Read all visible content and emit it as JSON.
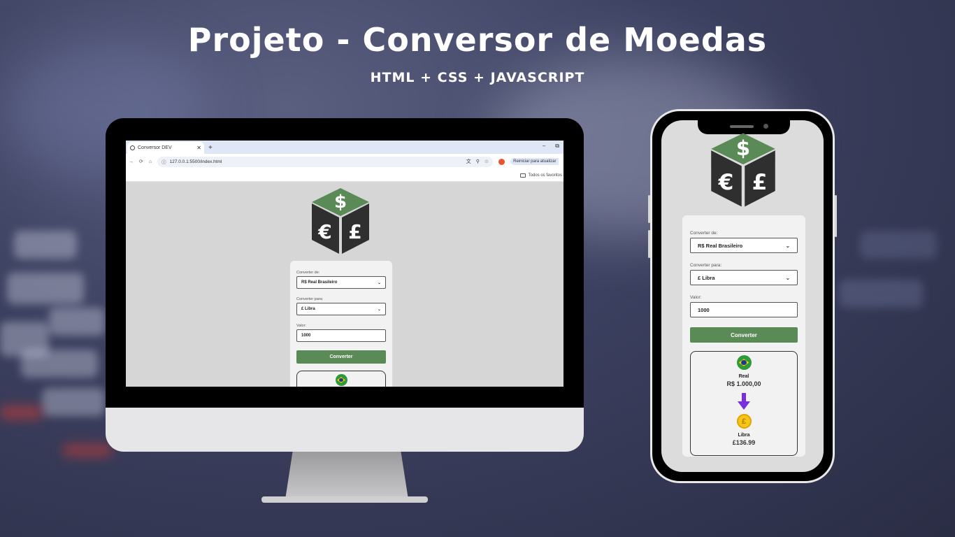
{
  "title": "Projeto - Conversor de Moedas",
  "subtitle": "HTML + CSS + JAVASCRIPT",
  "browser": {
    "tab_title": "Conversor DEV",
    "tab_close": "✕",
    "new_tab": "+",
    "minimize": "–",
    "restore": "⧉",
    "url": "127.0.0.1:5500/index.html",
    "update_button": "Reiniciar para atualizar",
    "bookmark_folder": "Todos os favoritos"
  },
  "app": {
    "from_label": "Converter de:",
    "from_value": "R$ Real Brasileiro",
    "to_label": "Converter para:",
    "to_value": "£ Libra",
    "amount_label": "Valor:",
    "amount_value": "1000",
    "convert_button": "Converter",
    "result_from_name": "Real",
    "result_from_value": "R$ 1.000,00",
    "result_to_name": "Libra",
    "result_to_value": "£136.99",
    "coin_symbol": "£",
    "chevron": "⌄"
  },
  "colors": {
    "brand_green": "#5a8a55",
    "arrow_purple": "#7a2ee0",
    "coin_gold": "#f5c518",
    "cube_dark": "#2f2f2f"
  }
}
